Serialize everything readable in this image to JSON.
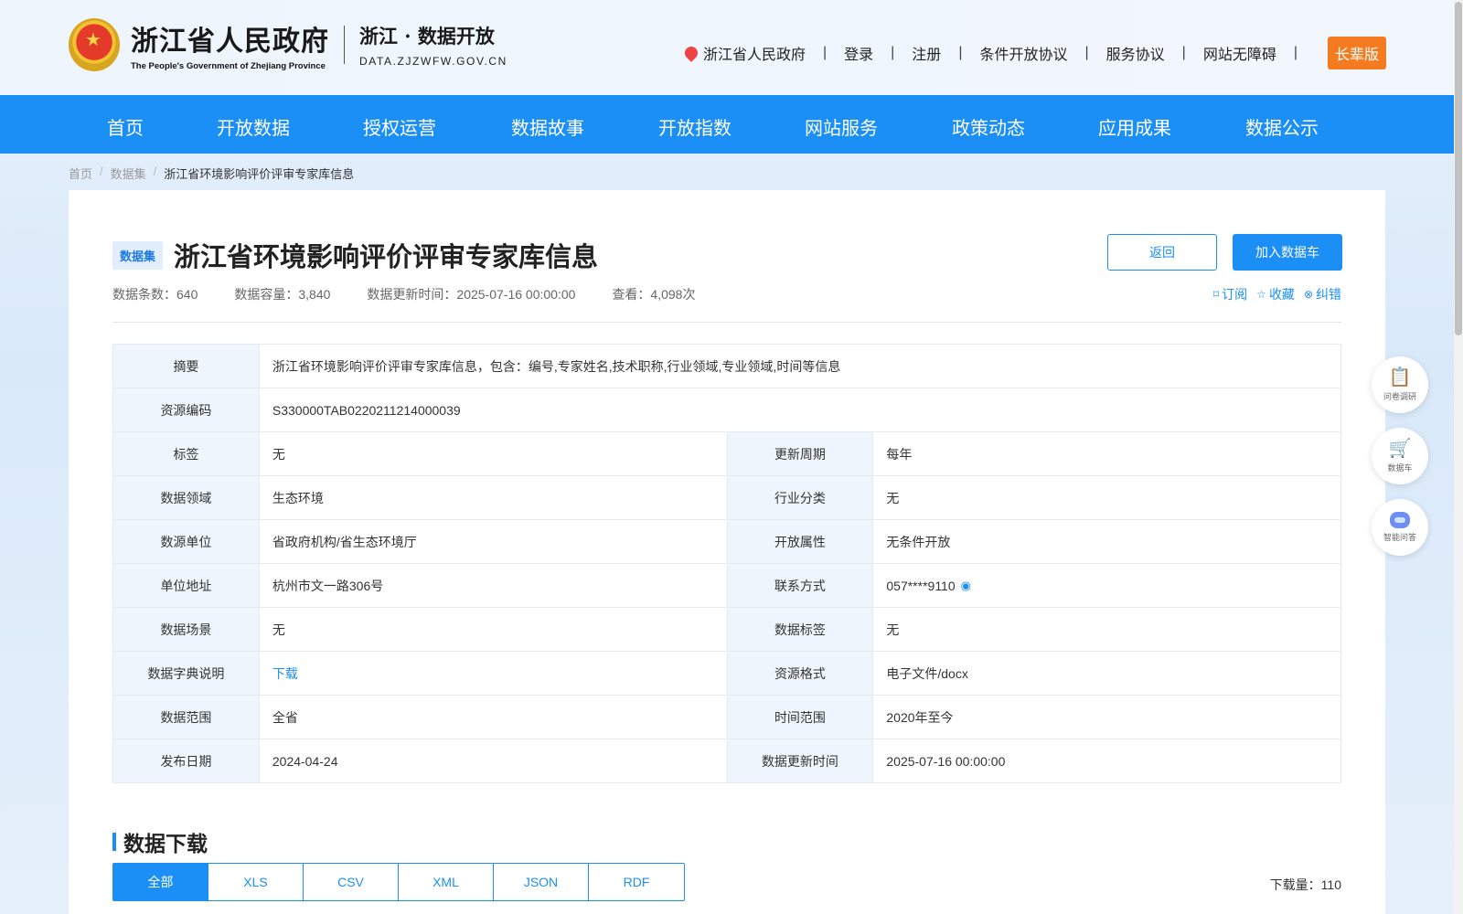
{
  "header": {
    "gov_name_cn": "浙江省人民政府",
    "gov_name_en": "The People's Government of Zhejiang Province",
    "site_name_cn": "浙江 · 数据开放",
    "site_name_en": "DATA.ZJZWFW.GOV.CN",
    "links": [
      "浙江省人民政府",
      "登录",
      "注册",
      "条件开放协议",
      "服务协议",
      "网站无障碍"
    ],
    "elder_mode": "长辈版"
  },
  "nav": [
    "首页",
    "开放数据",
    "授权运营",
    "数据故事",
    "开放指数",
    "网站服务",
    "政策动态",
    "应用成果",
    "数据公示"
  ],
  "breadcrumb": [
    "首页",
    "数据集",
    "浙江省环境影响评价评审专家库信息"
  ],
  "dataset": {
    "tag": "数据集",
    "title": "浙江省环境影响评价评审专家库信息",
    "meta": {
      "count": "数据条数：640",
      "capacity": "数据容量：3,840",
      "updated": "数据更新时间：2025-07-16 00:00:00",
      "views": "查看：4,098次"
    },
    "back_label": "返回",
    "add_label": "加入数据车",
    "subscribe": "订阅",
    "favorite": "收藏",
    "report": "纠错"
  },
  "info": {
    "summary_label": "摘要",
    "summary": "浙江省环境影响评价评审专家库信息，包含：编号,专家姓名,技术职称,行业领域,专业领域,时间等信息",
    "code_label": "资源编码",
    "code": "S330000TAB0220211214000039",
    "rows": [
      {
        "l1": "标签",
        "v1": "无",
        "l2": "更新周期",
        "v2": "每年"
      },
      {
        "l1": "数据领域",
        "v1": "生态环境",
        "l2": "行业分类",
        "v2": "无"
      },
      {
        "l1": "数源单位",
        "v1": "省政府机构/省生态环境厅",
        "l2": "开放属性",
        "v2": "无条件开放"
      },
      {
        "l1": "单位地址",
        "v1": "杭州市文一路306号",
        "l2": "联系方式",
        "v2": "057****9110"
      },
      {
        "l1": "数据场景",
        "v1": "无",
        "l2": "数据标签",
        "v2": "无"
      },
      {
        "l1": "数据字典说明",
        "v1": "下载",
        "l2": "资源格式",
        "v2": "电子文件/docx"
      },
      {
        "l1": "数据范围",
        "v1": "全省",
        "l2": "时间范围",
        "v2": "2020年至今"
      },
      {
        "l1": "发布日期",
        "v1": "2024-04-24",
        "l2": "数据更新时间",
        "v2": "2025-07-16 00:00:00"
      }
    ]
  },
  "download": {
    "title": "数据下载",
    "formats": [
      "全部",
      "XLS",
      "CSV",
      "XML",
      "JSON",
      "RDF"
    ],
    "count": "下载量：110"
  },
  "floats": [
    "问卷调研",
    "数据车",
    "智能问答"
  ],
  "colors": {
    "primary": "#1b8ff5",
    "elder": "#f47b20"
  }
}
